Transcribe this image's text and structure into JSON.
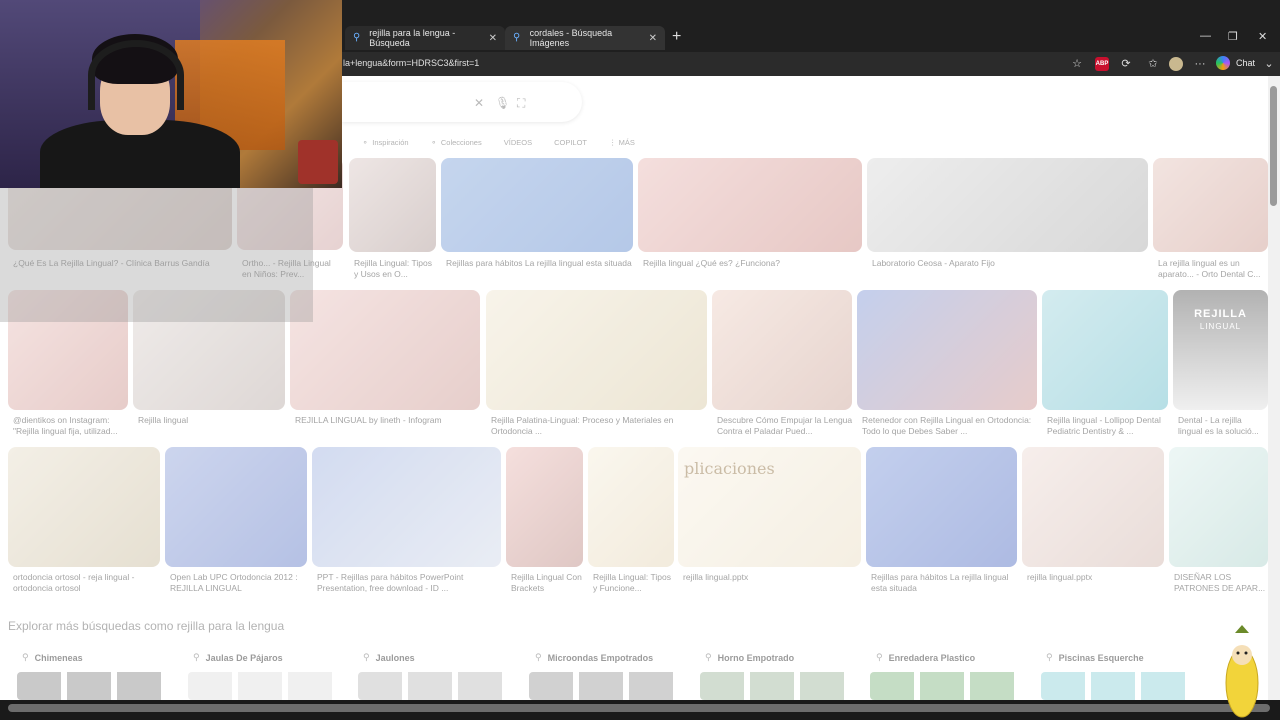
{
  "browser": {
    "tabs": [
      {
        "title": "rejilla para la lengua - Búsqueda",
        "close": "✕"
      },
      {
        "title": "cordales - Búsqueda Imágenes",
        "close": "✕"
      }
    ],
    "new_tab": "+",
    "url": "la+lengua&form=HDRSC3&first=1",
    "chat_label": "Chat",
    "window_controls": {
      "minimize": "—",
      "restore": "❐",
      "close": "✕"
    }
  },
  "filters": [
    "Inspiración",
    "Colecciones",
    "VÍDEOS",
    "COPILOT",
    "⋮ MÁS"
  ],
  "results": [
    {
      "caption": "¿Qué Es La Rejilla Lingual? - Clínica Barrus Gandía"
    },
    {
      "caption": "Ortho... - Rejilla Lingual en Niños: Prev..."
    },
    {
      "caption": "Rejilla Lingual: Tipos y Usos en O..."
    },
    {
      "caption": "Rejillas para hábitos La rejilla lingual esta situada"
    },
    {
      "caption": "Rejilla lingual ¿Qué es? ¿Funciona?"
    },
    {
      "caption": "Laboratorio Ceosa - Aparato Fijo"
    },
    {
      "caption": "La rejilla lingual es un aparato... - Orto Dental C..."
    },
    {
      "caption": "@dientikos on Instagram: \"Rejilla lingual fija, utilizad..."
    },
    {
      "caption": "Rejilla lingual"
    },
    {
      "caption": "REJILLA LINGUAL by lineth - Infogram"
    },
    {
      "caption": "Rejilla Palatina-Lingual: Proceso y Materiales en Ortodoncia ..."
    },
    {
      "caption": "Descubre Cómo Empujar la Lengua Contra el Paladar Pued..."
    },
    {
      "caption": "Retenedor con Rejilla Lingual en Ortodoncia: Todo lo que Debes Saber ..."
    },
    {
      "caption": "Rejilla lingual - Lollipop Dental Pediatric Dentistry & ..."
    },
    {
      "caption": "Dental - La rejilla lingual es la solució..."
    },
    {
      "caption": "ortodoncia ortosol - reja lingual - ortodoncia ortosol"
    },
    {
      "caption": "Open Lab UPC Ortodoncia 2012 : REJILLA LINGUAL"
    },
    {
      "caption": "PPT - Rejillas para hábitos PowerPoint Presentation, free download - ID ..."
    },
    {
      "caption": "Rejilla Lingual Con Brackets"
    },
    {
      "caption": "Rejilla Lingual: Tipos y Funcione..."
    },
    {
      "caption": "rejilla lingual.pptx"
    },
    {
      "caption": "Rejillas para hábitos La rejilla lingual esta situada"
    },
    {
      "caption": "rejilla lingual.pptx"
    },
    {
      "caption": "DISEÑAR LOS PATRONES DE APAR..."
    }
  ],
  "tile_text": {
    "rejilla_label": "REJILLA",
    "lingual_label": "LINGUAL",
    "aplicaciones": "plicaciones"
  },
  "explore": {
    "title": "Explorar más búsquedas como rejilla para la lengua",
    "items": [
      "Chimeneas",
      "Jaulas De Pájaros",
      "Jaulones",
      "Microondas Empotrados",
      "Horno Empotrado",
      "Enredadera Plastico",
      "Piscinas Esquerche"
    ]
  },
  "colors": {
    "accent": "#3c7ee8",
    "page_bg": "#ffffff",
    "chrome": "#1f1f1f"
  }
}
